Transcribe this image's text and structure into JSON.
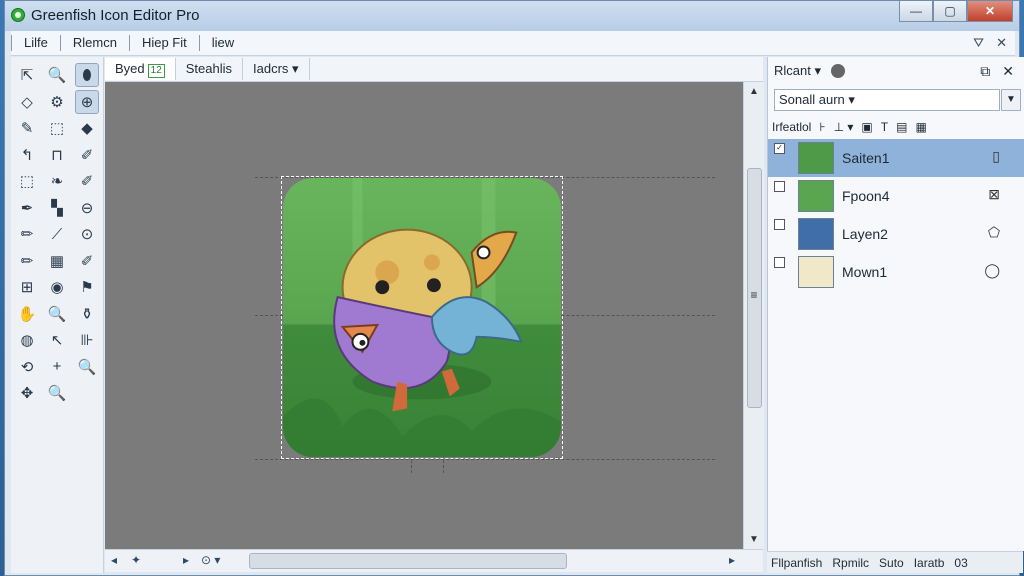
{
  "window": {
    "title": "Greenfish Icon Editor Pro",
    "buttons": {
      "minimize": "—",
      "maximize": "▢",
      "close": "✕"
    }
  },
  "menu": {
    "items": [
      "Lilfe",
      "Rlemcn",
      "Hiep Fit",
      "liew"
    ],
    "right_icons": [
      "filter-icon",
      "close-icon"
    ]
  },
  "toolbox": {
    "tools": [
      {
        "name": "pointer-tool-icon",
        "glyph": "⇱"
      },
      {
        "name": "zoom-tool-icon",
        "glyph": "🔍"
      },
      {
        "name": "shield-tool-icon",
        "glyph": "⬮"
      },
      {
        "name": "diamond-select-icon",
        "glyph": "◇"
      },
      {
        "name": "magic-wand-icon",
        "glyph": "⚙"
      },
      {
        "name": "zoom-in-icon",
        "glyph": "⊕"
      },
      {
        "name": "pencil-icon",
        "glyph": "✎"
      },
      {
        "name": "rect-select-icon",
        "glyph": "⬚"
      },
      {
        "name": "fill-icon",
        "glyph": "◆"
      },
      {
        "name": "lasso-icon",
        "glyph": "↰"
      },
      {
        "name": "stamp-icon",
        "glyph": "⊓"
      },
      {
        "name": "eyedrop-icon",
        "glyph": "✐"
      },
      {
        "name": "dotted-select-icon",
        "glyph": "⬚"
      },
      {
        "name": "leaf-icon",
        "glyph": "❧"
      },
      {
        "name": "smudge-icon",
        "glyph": "✐"
      },
      {
        "name": "brush-icon",
        "glyph": "✒"
      },
      {
        "name": "checker-icon",
        "glyph": "▚"
      },
      {
        "name": "zoom-out-icon",
        "glyph": "⊖"
      },
      {
        "name": "spray-icon",
        "glyph": "✏"
      },
      {
        "name": "line-icon",
        "glyph": "⟋"
      },
      {
        "name": "circle-zoom-icon",
        "glyph": "⊙"
      },
      {
        "name": "eraser-icon",
        "glyph": "✏"
      },
      {
        "name": "color-swatch-icon",
        "glyph": "▦"
      },
      {
        "name": "blur-icon",
        "glyph": "✐"
      },
      {
        "name": "crop-icon",
        "glyph": "⊞"
      },
      {
        "name": "gradient-icon",
        "glyph": "◉"
      },
      {
        "name": "text-flag-icon",
        "glyph": "⚑"
      },
      {
        "name": "hand-icon",
        "glyph": "✋"
      },
      {
        "name": "magnify-icon",
        "glyph": "🔍"
      },
      {
        "name": "bucket-icon",
        "glyph": "⚱"
      },
      {
        "name": "globe-icon",
        "glyph": "◍"
      },
      {
        "name": "cursor-icon",
        "glyph": "↖"
      },
      {
        "name": "flip-icon",
        "glyph": "⊪"
      },
      {
        "name": "transform-icon",
        "glyph": "⟲"
      },
      {
        "name": "plus-icon",
        "glyph": "+"
      },
      {
        "name": "search-large-icon",
        "glyph": "🔍"
      },
      {
        "name": "move-icon",
        "glyph": "✥"
      },
      {
        "name": "zoom-small-icon",
        "glyph": "🔍"
      }
    ]
  },
  "document": {
    "tabs": [
      {
        "label": "Byed",
        "badge": "12"
      },
      {
        "label": "Steahlis",
        "badge": ""
      },
      {
        "label": "Iadcrs ▾",
        "badge": ""
      }
    ]
  },
  "hscroll": {
    "items": [
      "◂",
      "✦",
      "▸",
      "⊙ ▾",
      "▸"
    ]
  },
  "vscroll": {
    "up": "▲",
    "down": "▼",
    "grip": "≡"
  },
  "panel": {
    "title": "Rlcant ▾",
    "blend_mode": "Sonall aurn ▾",
    "toolbar": [
      "Irfeatlol",
      "⊦",
      "⊥ ▾",
      "▣",
      "T",
      "▤",
      "▦"
    ],
    "layers": [
      {
        "name": "Saiten1",
        "selected": true,
        "checked": true
      },
      {
        "name": "Fpoon4",
        "selected": false,
        "checked": false
      },
      {
        "name": "Layen2",
        "selected": false,
        "checked": false
      },
      {
        "name": "Mown1",
        "selected": false,
        "checked": false
      }
    ]
  },
  "status": {
    "items": [
      "Fllpanfish",
      "Rpmilc",
      "Suto",
      "Iaratb",
      "03"
    ]
  },
  "colors": {
    "canvas_bg": "#7b7b7b",
    "selected_layer": "#8fb2da",
    "icon_green": "#5aa650"
  }
}
